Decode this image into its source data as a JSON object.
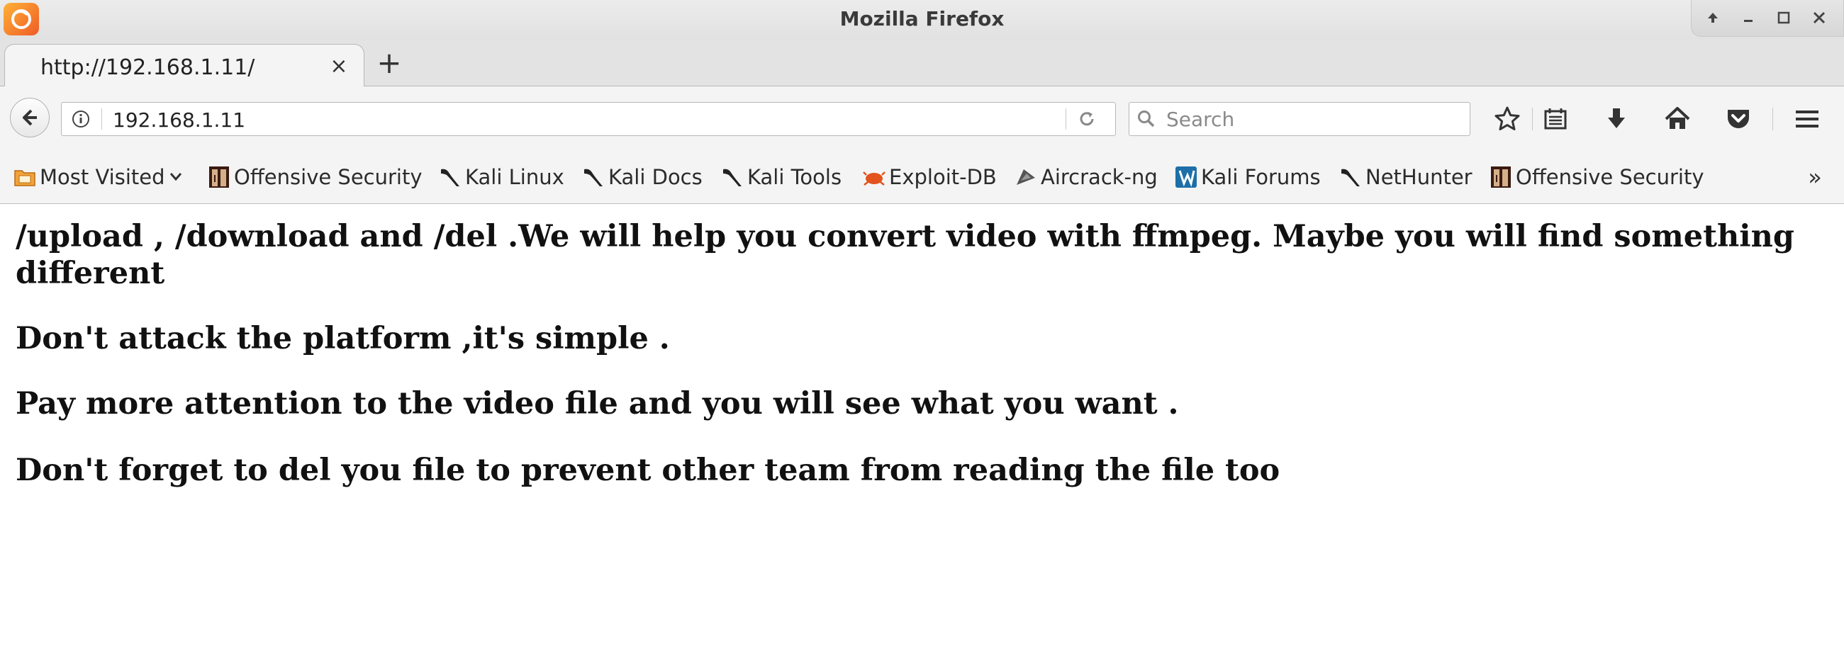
{
  "window": {
    "title": "Mozilla Firefox"
  },
  "tab": {
    "title": "http://192.168.1.11/",
    "close_label": "×",
    "new_tab_label": "+"
  },
  "navbar": {
    "url": "192.168.1.11",
    "search_placeholder": "Search"
  },
  "bookmarks": {
    "items": [
      {
        "label": "Most Visited",
        "icon": "folder-icon"
      },
      {
        "label": "Offensive Security",
        "icon": "offsec-icon"
      },
      {
        "label": "Kali Linux",
        "icon": "kali-dragon-icon"
      },
      {
        "label": "Kali Docs",
        "icon": "kali-dragon-icon"
      },
      {
        "label": "Kali Tools",
        "icon": "kali-dragon-icon"
      },
      {
        "label": "Exploit-DB",
        "icon": "exploitdb-icon"
      },
      {
        "label": "Aircrack-ng",
        "icon": "aircrack-icon"
      },
      {
        "label": "Kali Forums",
        "icon": "kali-forums-icon"
      },
      {
        "label": "NetHunter",
        "icon": "kali-dragon-icon"
      },
      {
        "label": "Offensive Security",
        "icon": "offsec-icon"
      }
    ],
    "overflow_label": "»"
  },
  "page": {
    "headings": [
      "/upload , /download and /del .We will help you convert video with ffmpeg. Maybe you will find something different",
      "Don't attack the platform ,it's simple .",
      "Pay more attention to the video file and you will see what you want .",
      "Don't forget to del you file to prevent other team from reading the file too"
    ]
  },
  "colors": {
    "firefox_orange": "#ef5b25",
    "toolbar_bg": "#f4f4f4",
    "exploitdb_orange": "#e2531e",
    "kali_forums_blue": "#1e6fa8"
  }
}
